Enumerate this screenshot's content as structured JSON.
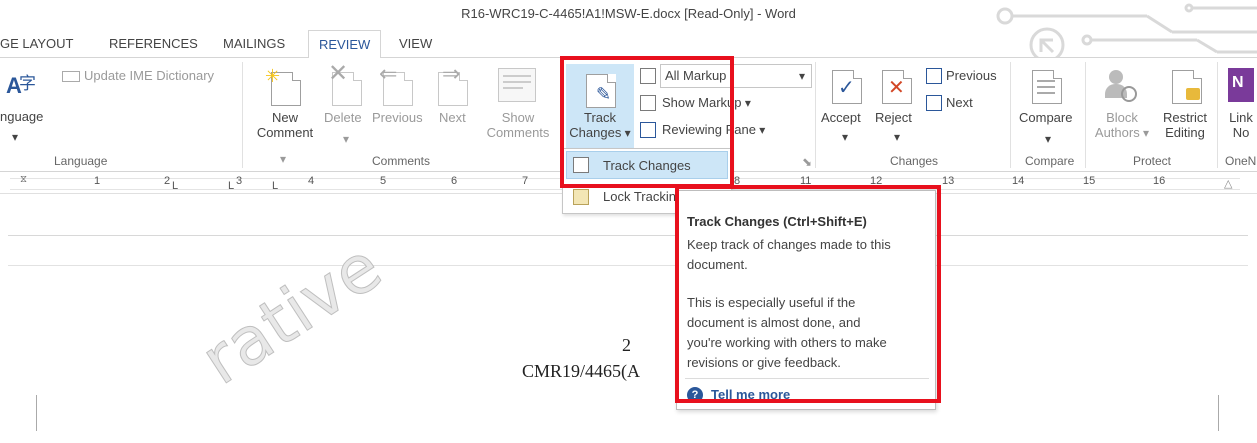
{
  "window": {
    "title": "R16-WRC19-C-4465!A1!MSW-E.docx [Read-Only] - Word"
  },
  "tabs": [
    "GE LAYOUT",
    "REFERENCES",
    "MAILINGS",
    "REVIEW",
    "VIEW"
  ],
  "ribbon": {
    "language": {
      "group_label": "Language",
      "language_label": "nguage",
      "update_ime_label": "Update IME Dictionary",
      "ime_glyph": "字"
    },
    "comments": {
      "group_label": "Comments",
      "new_comment": [
        "New",
        "Comment"
      ],
      "delete": "Delete",
      "previous": "Previous",
      "next": "Next",
      "show_comments": [
        "Show",
        "Comments"
      ]
    },
    "tracking": {
      "track_changes": [
        "Track",
        "Changes"
      ],
      "markup_combo_value": "All Markup",
      "show_markup": "Show Markup",
      "reviewing_pane": "Reviewing Pane",
      "dropdown_items": [
        "Track Changes",
        "Lock Tracking"
      ]
    },
    "changes": {
      "group_label": "Changes",
      "accept": "Accept",
      "reject": "Reject",
      "previous": "Previous",
      "next": "Next"
    },
    "compare": {
      "group_label": "Compare",
      "compare": "Compare"
    },
    "protect": {
      "group_label": "Protect",
      "block_authors": [
        "Block",
        "Authors"
      ],
      "restrict_editing": [
        "Restrict",
        "Editing"
      ]
    },
    "onenote": {
      "group_label": "OneN",
      "linked_notes": [
        "Link",
        "No"
      ]
    }
  },
  "ruler": {
    "numbers": [
      "1",
      "2",
      "3",
      "4",
      "5",
      "6",
      "7",
      "8",
      "11",
      "12",
      "13",
      "14",
      "15",
      "16"
    ]
  },
  "tooltip": {
    "title": "Track Changes (Ctrl+Shift+E)",
    "line1": [
      "Keep track of changes made to this",
      "document."
    ],
    "line2": [
      "This is especially useful if the",
      "document is almost done, and",
      "you're working with others to make",
      "revisions or give feedback."
    ],
    "link": "Tell me more"
  },
  "document": {
    "page_number": "2",
    "doc_ref": "CMR19/4465(A"
  },
  "watermark": "rative",
  "colors": {
    "accent": "#2b579a",
    "highlight": "#cde6f7",
    "annotation": "#e8101d"
  }
}
